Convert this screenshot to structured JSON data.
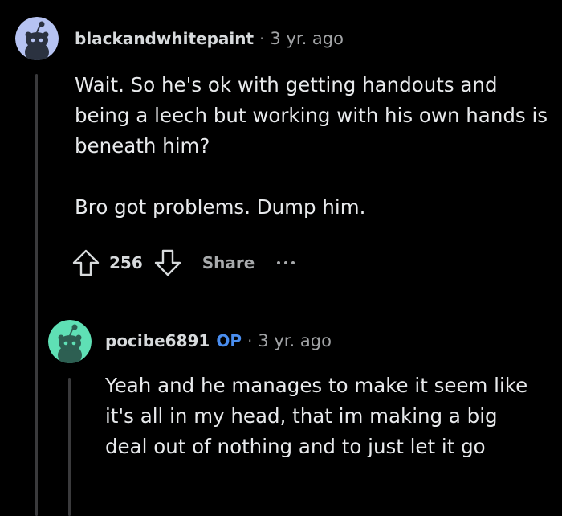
{
  "comments": [
    {
      "username": "blackandwhitepaint",
      "separator": "·",
      "time": "3 yr. ago",
      "avatar_color": "#b6c3f2",
      "paragraphs": [
        "Wait. So he's ok with getting handouts and being a leech but working with his own hands is beneath him?",
        "Bro got problems. Dump him."
      ],
      "score": "256",
      "share_label": "Share",
      "upvote_icon": "arrow-up-outline-icon",
      "downvote_icon": "arrow-down-outline-icon",
      "more_icon": "ellipsis-icon"
    },
    {
      "username": "pocibe6891",
      "op_badge": "OP",
      "separator": "·",
      "time": "3 yr. ago",
      "avatar_color": "#5fe0b5",
      "paragraphs": [
        "Yeah and he manages to make it seem like it's all in my head, that im making a big deal out of nothing and to just let it go"
      ]
    }
  ],
  "colors": {
    "background": "#000000",
    "op_badge": "#4a8ef0",
    "thread_line": "#3a3a3c"
  }
}
